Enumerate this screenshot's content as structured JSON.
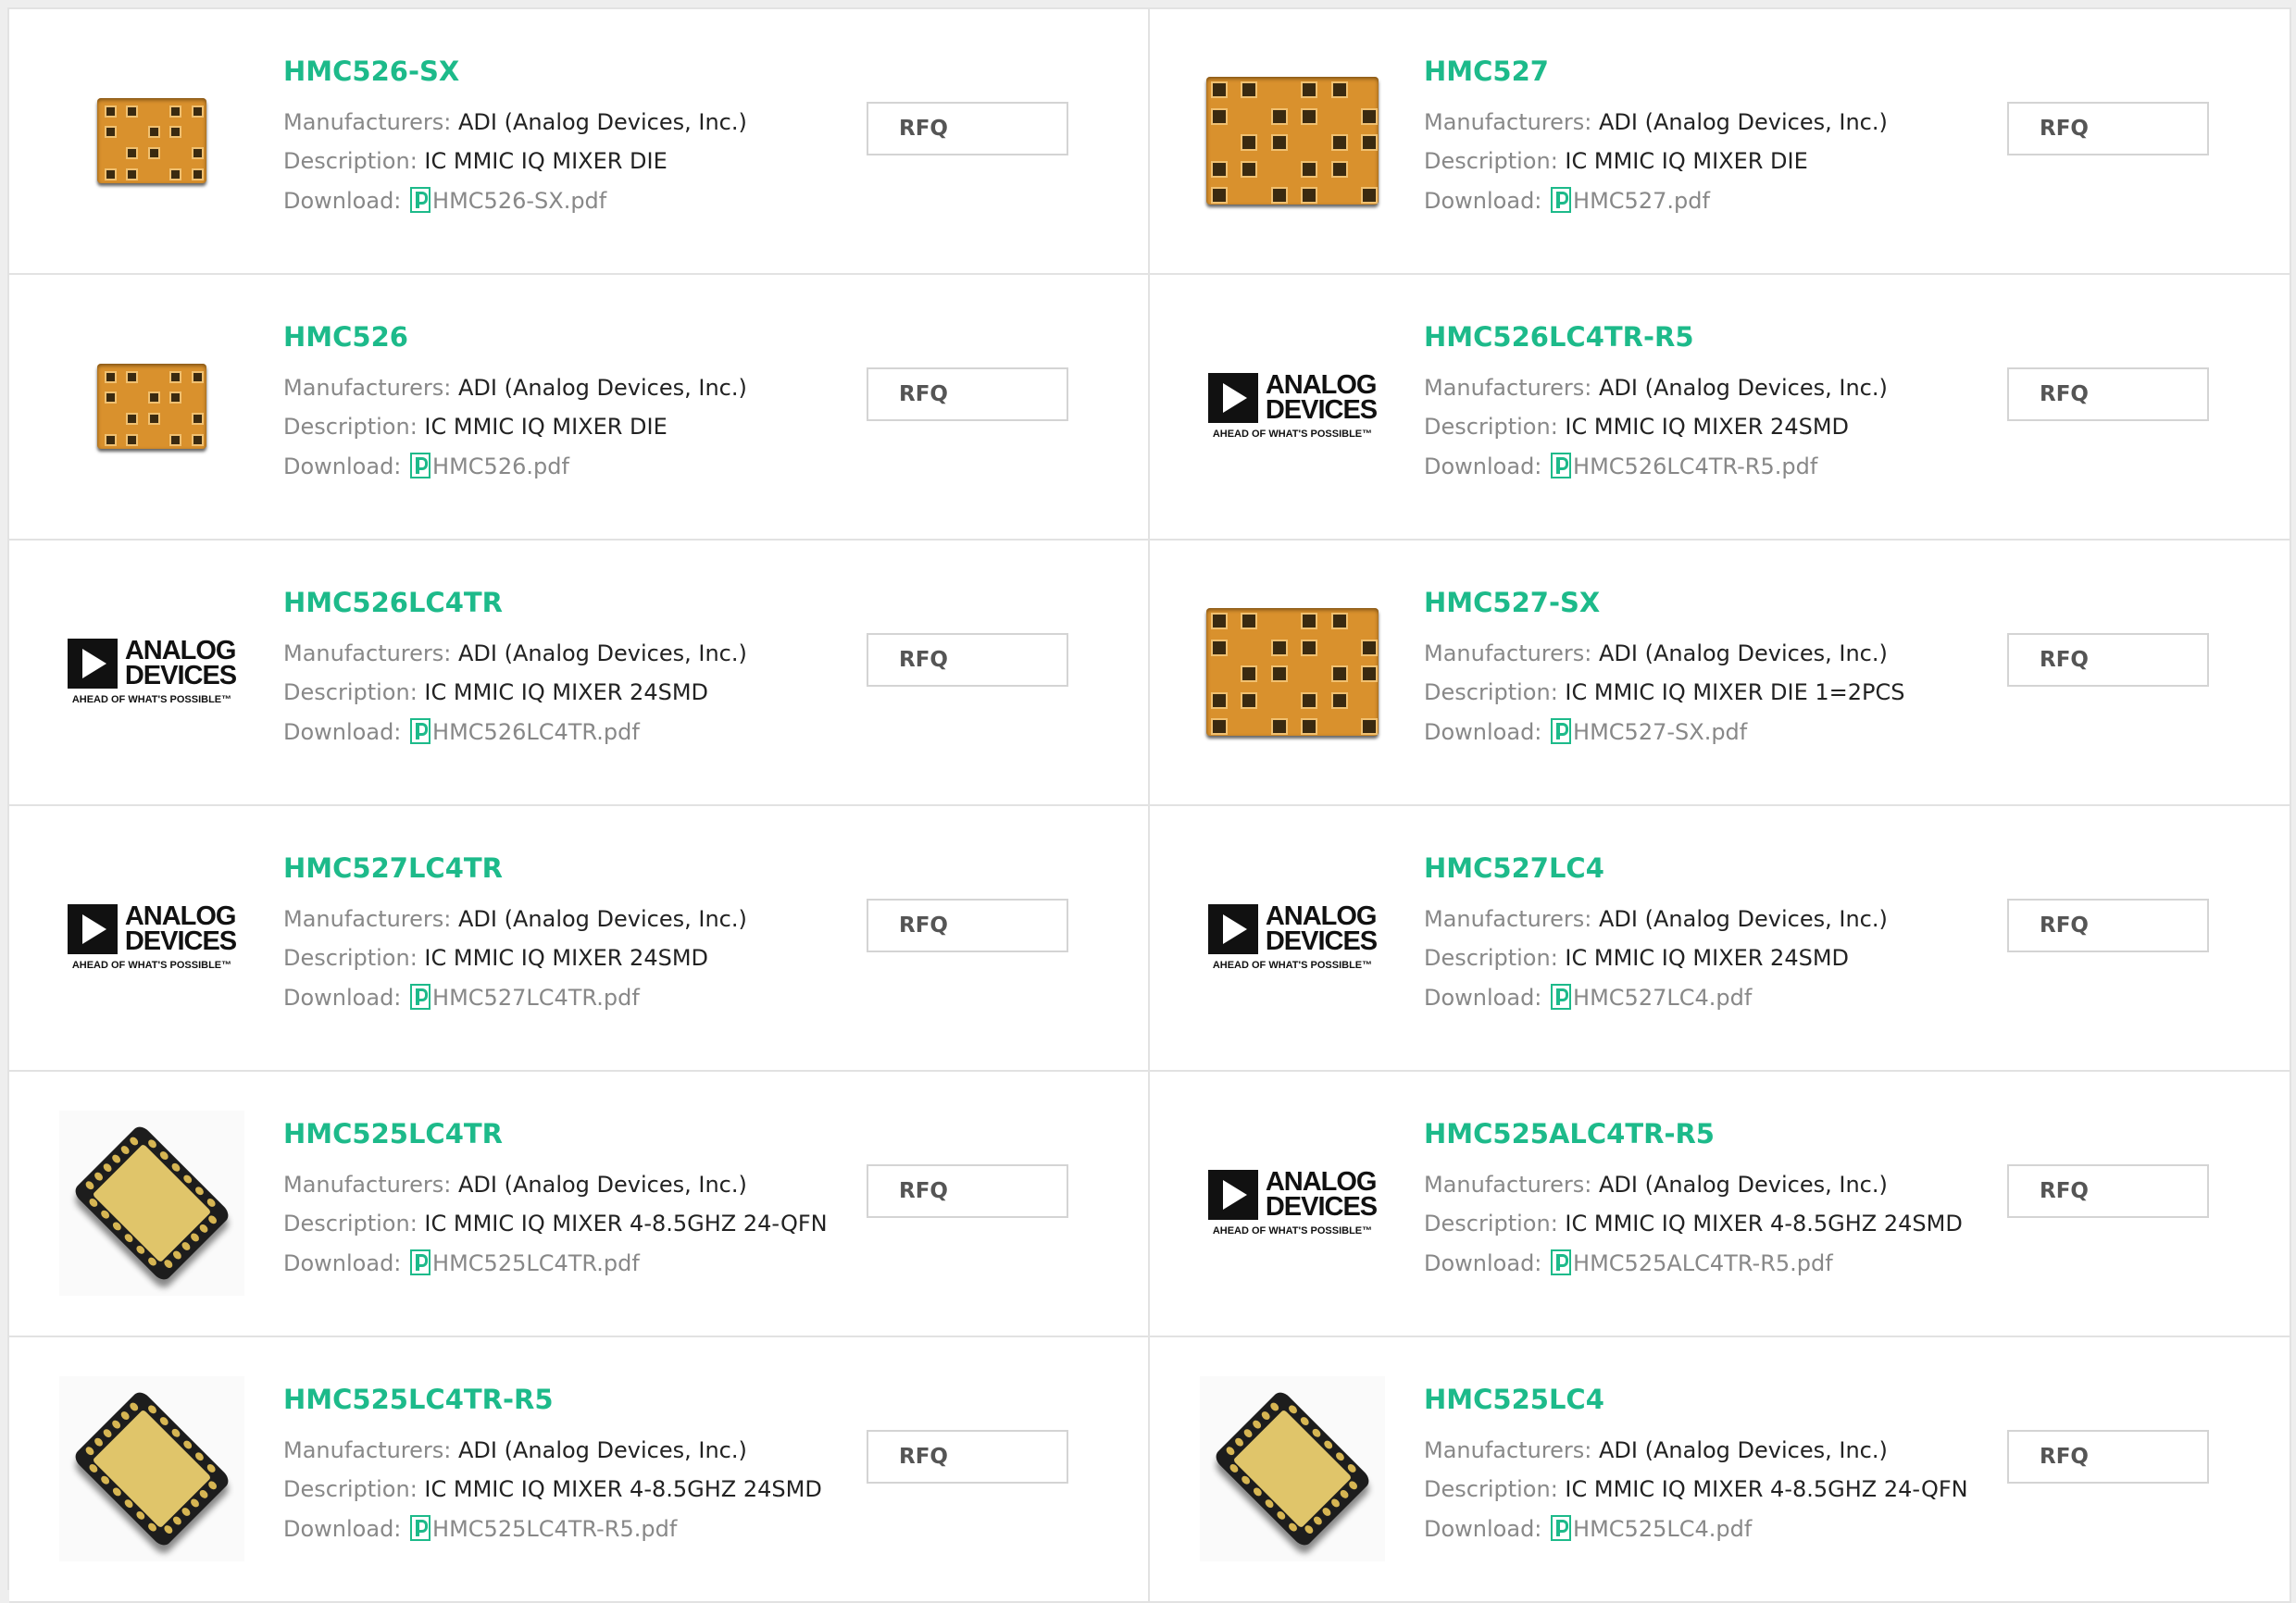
{
  "labels": {
    "manufacturers": "Manufacturers:",
    "description": "Description:",
    "download": "Download:",
    "rfq": "RFQ"
  },
  "logo": {
    "line1": "ANALOG",
    "line2": "DEVICES",
    "tagline": "AHEAD OF WHAT'S POSSIBLE™"
  },
  "products": [
    {
      "name": "HMC526-SX",
      "manufacturer": "ADI (Analog Devices, Inc.)",
      "description": "IC MMIC IQ MIXER DIE",
      "file": "HMC526-SX.pdf",
      "image": "die-small"
    },
    {
      "name": "HMC527",
      "manufacturer": "ADI (Analog Devices, Inc.)",
      "description": "IC MMIC IQ MIXER DIE",
      "file": "HMC527.pdf",
      "image": "die-large"
    },
    {
      "name": "HMC526",
      "manufacturer": "ADI (Analog Devices, Inc.)",
      "description": "IC MMIC IQ MIXER DIE",
      "file": "HMC526.pdf",
      "image": "die-small"
    },
    {
      "name": "HMC526LC4TR-R5",
      "manufacturer": "ADI (Analog Devices, Inc.)",
      "description": "IC MMIC IQ MIXER 24SMD",
      "file": "HMC526LC4TR-R5.pdf",
      "image": "adi-logo"
    },
    {
      "name": "HMC526LC4TR",
      "manufacturer": "ADI (Analog Devices, Inc.)",
      "description": "IC MMIC IQ MIXER 24SMD",
      "file": "HMC526LC4TR.pdf",
      "image": "adi-logo"
    },
    {
      "name": "HMC527-SX",
      "manufacturer": "ADI (Analog Devices, Inc.)",
      "description": "IC MMIC IQ MIXER DIE 1=2PCS",
      "file": "HMC527-SX.pdf",
      "image": "die-large"
    },
    {
      "name": "HMC527LC4TR",
      "manufacturer": "ADI (Analog Devices, Inc.)",
      "description": "IC MMIC IQ MIXER 24SMD",
      "file": "HMC527LC4TR.pdf",
      "image": "adi-logo"
    },
    {
      "name": "HMC527LC4",
      "manufacturer": "ADI (Analog Devices, Inc.)",
      "description": "IC MMIC IQ MIXER 24SMD",
      "file": "HMC527LC4.pdf",
      "image": "adi-logo"
    },
    {
      "name": "HMC525LC4TR",
      "manufacturer": "ADI (Analog Devices, Inc.)",
      "description": "IC MMIC IQ MIXER 4-8.5GHZ 24-QFN",
      "file": "HMC525LC4TR.pdf",
      "image": "qfn"
    },
    {
      "name": "HMC525ALC4TR-R5",
      "manufacturer": "ADI (Analog Devices, Inc.)",
      "description": "IC MMIC IQ MIXER 4-8.5GHZ 24SMD",
      "file": "HMC525ALC4TR-R5.pdf",
      "image": "adi-logo"
    },
    {
      "name": "HMC525LC4TR-R5",
      "manufacturer": "ADI (Analog Devices, Inc.)",
      "description": "IC MMIC IQ MIXER 4-8.5GHZ 24SMD",
      "file": "HMC525LC4TR-R5.pdf",
      "image": "qfn"
    },
    {
      "name": "HMC525LC4",
      "manufacturer": "ADI (Analog Devices, Inc.)",
      "description": "IC MMIC IQ MIXER 4-8.5GHZ 24-QFN",
      "file": "HMC525LC4.pdf",
      "image": "qfn"
    }
  ],
  "colors": {
    "accent": "#1dba8a",
    "border": "#e2e2e2",
    "label": "#888888",
    "die": "#d9912d"
  }
}
